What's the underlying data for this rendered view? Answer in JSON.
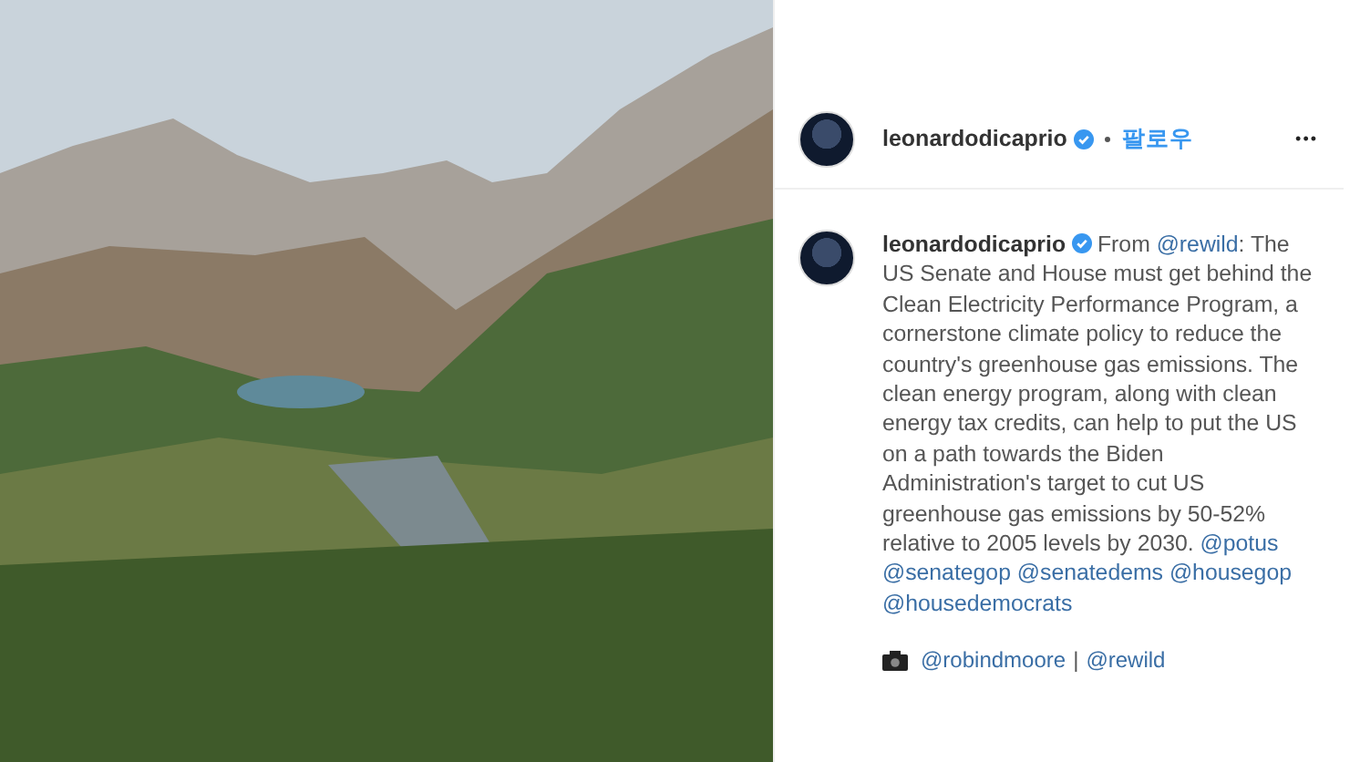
{
  "post": {
    "username": "leonardodicaprio",
    "verified": true,
    "follow_label": "팔로우",
    "more_label": "•••"
  },
  "caption": {
    "username": "leonardodicaprio",
    "verified": true,
    "parts": [
      {
        "kind": "text",
        "text": "From "
      },
      {
        "kind": "mention",
        "text": "@rewild"
      },
      {
        "kind": "text",
        "text": ": The US Senate and House must get behind the Clean Electricity Performance Program, a cornerstone climate policy to reduce the country's greenhouse gas emissions. The clean energy program, along with clean energy tax credits, can help to put the US on a path towards the Biden Administration's target to cut US greenhouse gas emissions by 50-52% relative to 2005 levels by 2030. "
      },
      {
        "kind": "mention",
        "text": "@potus"
      },
      {
        "kind": "mention",
        "text": "@senategop"
      },
      {
        "kind": "mention",
        "text": "@senatedems"
      },
      {
        "kind": "mention",
        "text": "@housegop"
      },
      {
        "kind": "mention",
        "text": "@housedemocrats"
      }
    ]
  },
  "credit": [
    {
      "kind": "mention",
      "text": "@robindmoore"
    },
    {
      "kind": "text",
      "text": "|"
    },
    {
      "kind": "mention",
      "text": "@rewild"
    }
  ]
}
